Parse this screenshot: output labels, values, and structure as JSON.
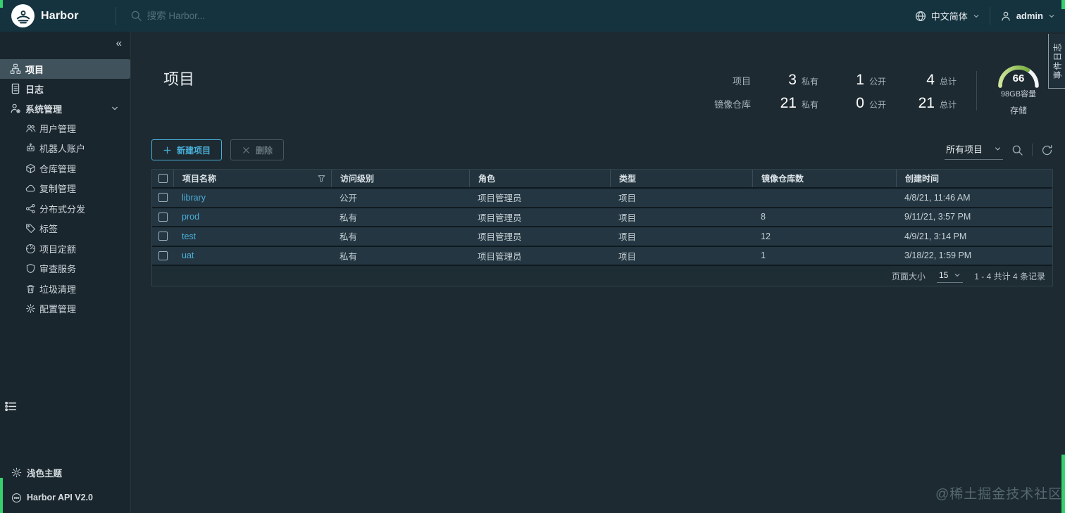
{
  "app": {
    "brand": "Harbor",
    "event_log_tab": "事件日志",
    "watermark": "@稀土掘金技术社区"
  },
  "header": {
    "search_placeholder": "搜索 Harbor...",
    "language": "中文简体",
    "username": "admin"
  },
  "sidebar": {
    "collapse_icon": "«",
    "items": {
      "projects": "项目",
      "logs": "日志",
      "system": "系统管理"
    },
    "system_children": [
      "用户管理",
      "机器人账户",
      "仓库管理",
      "复制管理",
      "分布式分发",
      "标签",
      "项目定额",
      "审查服务",
      "垃圾清理",
      "配置管理"
    ],
    "theme_toggle": "浅色主题",
    "api_link": "Harbor API V2.0"
  },
  "page": {
    "title": "项目",
    "stats": {
      "row1_label": "项目",
      "row2_label": "镜像仓库",
      "private_label": "私有",
      "public_label": "公开",
      "total_label": "总计",
      "projects_private": "3",
      "projects_public": "1",
      "projects_total": "4",
      "repos_private": "21",
      "repos_public": "0",
      "repos_total": "21"
    },
    "storage": {
      "value": "66",
      "capacity": "98GB容量",
      "label": "存储",
      "percent": 67
    }
  },
  "toolbar": {
    "new_project": "新建项目",
    "delete": "删除",
    "filter_selected": "所有项目"
  },
  "table": {
    "columns": [
      "项目名称",
      "访问级别",
      "角色",
      "类型",
      "镜像仓库数",
      "创建时间"
    ],
    "rows": [
      {
        "name": "library",
        "access": "公开",
        "role": "项目管理员",
        "type": "项目",
        "repos": "",
        "created": "4/8/21, 11:46 AM"
      },
      {
        "name": "prod",
        "access": "私有",
        "role": "项目管理员",
        "type": "项目",
        "repos": "8",
        "created": "9/11/21, 3:57 PM"
      },
      {
        "name": "test",
        "access": "私有",
        "role": "项目管理员",
        "type": "项目",
        "repos": "12",
        "created": "4/9/21, 3:14 PM"
      },
      {
        "name": "uat",
        "access": "私有",
        "role": "项目管理员",
        "type": "项目",
        "repos": "1",
        "created": "3/18/22, 1:59 PM"
      }
    ],
    "pagination": {
      "page_size_label": "页面大小",
      "page_size": "15",
      "summary": "1 - 4 共计 4 条记录"
    }
  },
  "colors": {
    "header_bg": "#15333F",
    "accent": "#49AFD9",
    "link": "#4AAED9",
    "recording_green": "#36D16E",
    "gauge_green": "#5D9E1E"
  }
}
